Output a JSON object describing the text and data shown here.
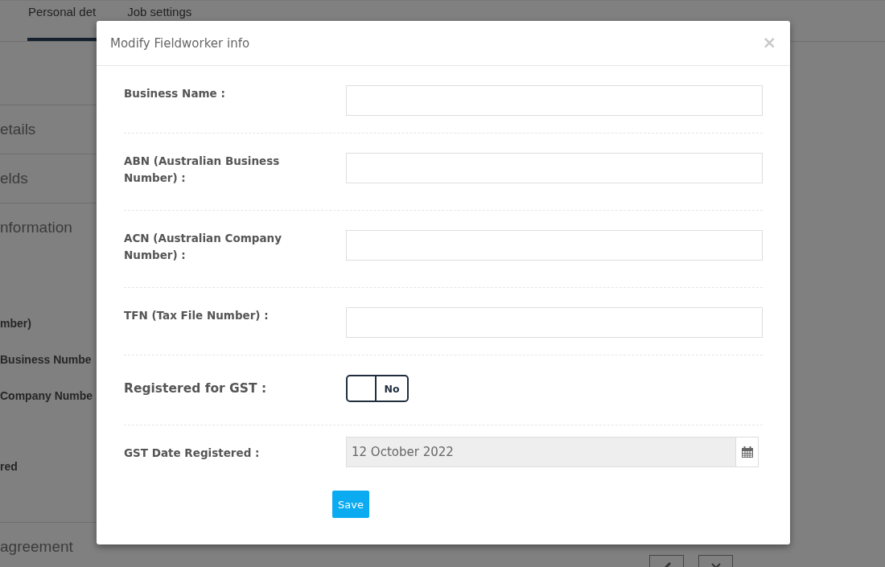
{
  "tabs": [
    {
      "label": "Personal det",
      "selected": true
    },
    {
      "label": "Job settings",
      "selected": false
    }
  ],
  "background_rows": [
    {
      "kind": "heading",
      "text": "etails"
    },
    {
      "kind": "heading",
      "text": "elds"
    },
    {
      "kind": "heading",
      "text": "nformation"
    },
    {
      "kind": "label",
      "text": "mber)"
    },
    {
      "kind": "label",
      "text": "Business Numbe"
    },
    {
      "kind": "label",
      "text": "Company Numbe"
    },
    {
      "kind": "label",
      "text": "red"
    },
    {
      "kind": "heading",
      "text": "agreement",
      "actions": true
    }
  ],
  "dialog": {
    "title": "Modify Fieldworker info",
    "close": "×",
    "fields": [
      {
        "kind": "text",
        "label": "Business Name :"
      },
      {
        "kind": "text",
        "label": "ABN (Australian Business Number) :"
      },
      {
        "kind": "text",
        "label": "ACN (Australian Company Number) :"
      },
      {
        "kind": "text",
        "label": "TFN (Tax File Number) :"
      },
      {
        "kind": "toggle",
        "label": "Registered for GST :",
        "on": false,
        "state_text": "No"
      },
      {
        "kind": "date",
        "label": "GST Date Registered :",
        "value": "12 October 2022",
        "disabled": true
      }
    ],
    "save": "Save"
  }
}
